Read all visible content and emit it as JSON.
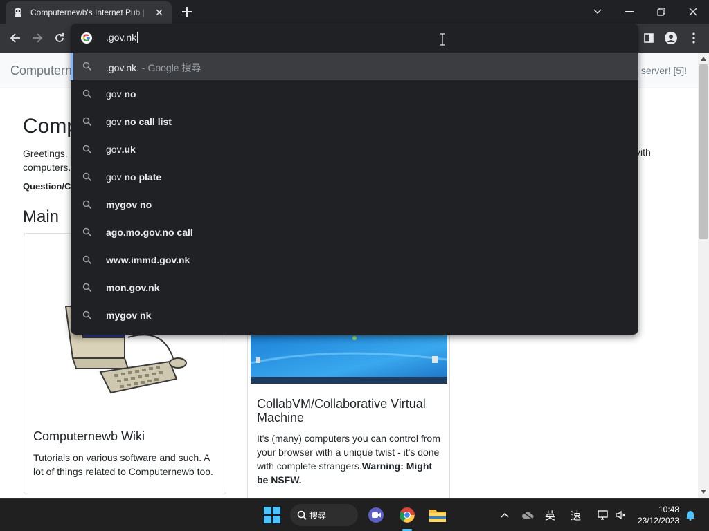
{
  "browser": {
    "tab_title": "Computernewb's Internet Pub | ",
    "tab_close": "✕",
    "new_tab": "+",
    "address_value": ".gov.nk"
  },
  "suggestions": [
    {
      "bold": ".gov.nk.",
      "normal": "",
      "sub": " - Google 搜尋",
      "selected": true
    },
    {
      "bold": "gov",
      "normal": " no",
      "sub": ""
    },
    {
      "bold": "gov",
      "normal": " no call list",
      "sub": ""
    },
    {
      "bold": "gov",
      "normal": ".uk",
      "sub": ""
    },
    {
      "bold": "gov",
      "normal": " no plate",
      "sub": ""
    },
    {
      "bold": "",
      "normal": "mygov no",
      "sub": ""
    },
    {
      "bold": "",
      "normal": "ago.mo.gov.no call",
      "sub": ""
    },
    {
      "bold": "",
      "normal": "www.immd.gov.nk",
      "sub": ""
    },
    {
      "bold": "",
      "normal": "mon.gov.nk",
      "sub": ""
    },
    {
      "bold": "",
      "normal": "mygov nk",
      "sub": ""
    }
  ],
  "page": {
    "brand": "Computerne",
    "nav_right": "server! [5]!",
    "heading": "Comp",
    "greeting_left": "Greetings. computers.",
    "greeting_right": "vith",
    "question": "Question/C",
    "main_heading": "Main",
    "cards": [
      {
        "title": "Computernewb Wiki",
        "text": "Tutorials on various software and such. A lot of things related to Computernewb too."
      },
      {
        "title": "CollabVM/Collaborative Virtual Machine",
        "text": "It's (many) computers you can control from your browser with a unique twist - it's done with complete strangers.",
        "warning": "Warning: Might be NSFW."
      }
    ]
  },
  "taskbar": {
    "search_label": "搜尋",
    "ime_lang": "英",
    "ime_mode": "速",
    "time": "10:48",
    "date": "23/12/2023"
  },
  "colors": {
    "chrome_dark": "#202124",
    "toolbar": "#35363a",
    "accent_blue": "#8ab4f8",
    "taskbar": "#202020"
  }
}
